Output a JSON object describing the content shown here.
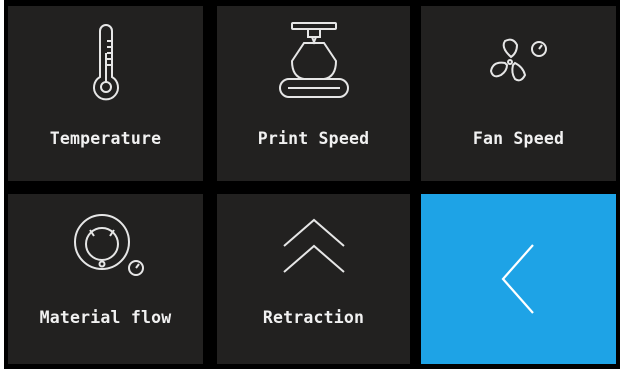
{
  "menu": {
    "tiles": [
      {
        "label": "Temperature",
        "icon": "thermometer-icon"
      },
      {
        "label": "Print Speed",
        "icon": "print-head-icon"
      },
      {
        "label": "Fan Speed",
        "icon": "fan-icon"
      },
      {
        "label": "Material flow",
        "icon": "filament-spool-icon"
      },
      {
        "label": "Retraction",
        "icon": "double-chevron-up-icon"
      },
      {
        "label": "",
        "icon": "chevron-left-icon"
      }
    ]
  },
  "colors": {
    "tile": "#222120",
    "background": "#000000",
    "back_button": "#1ea3e6",
    "icon_stroke": "#e6e6e6",
    "label": "#f1f1f1"
  }
}
